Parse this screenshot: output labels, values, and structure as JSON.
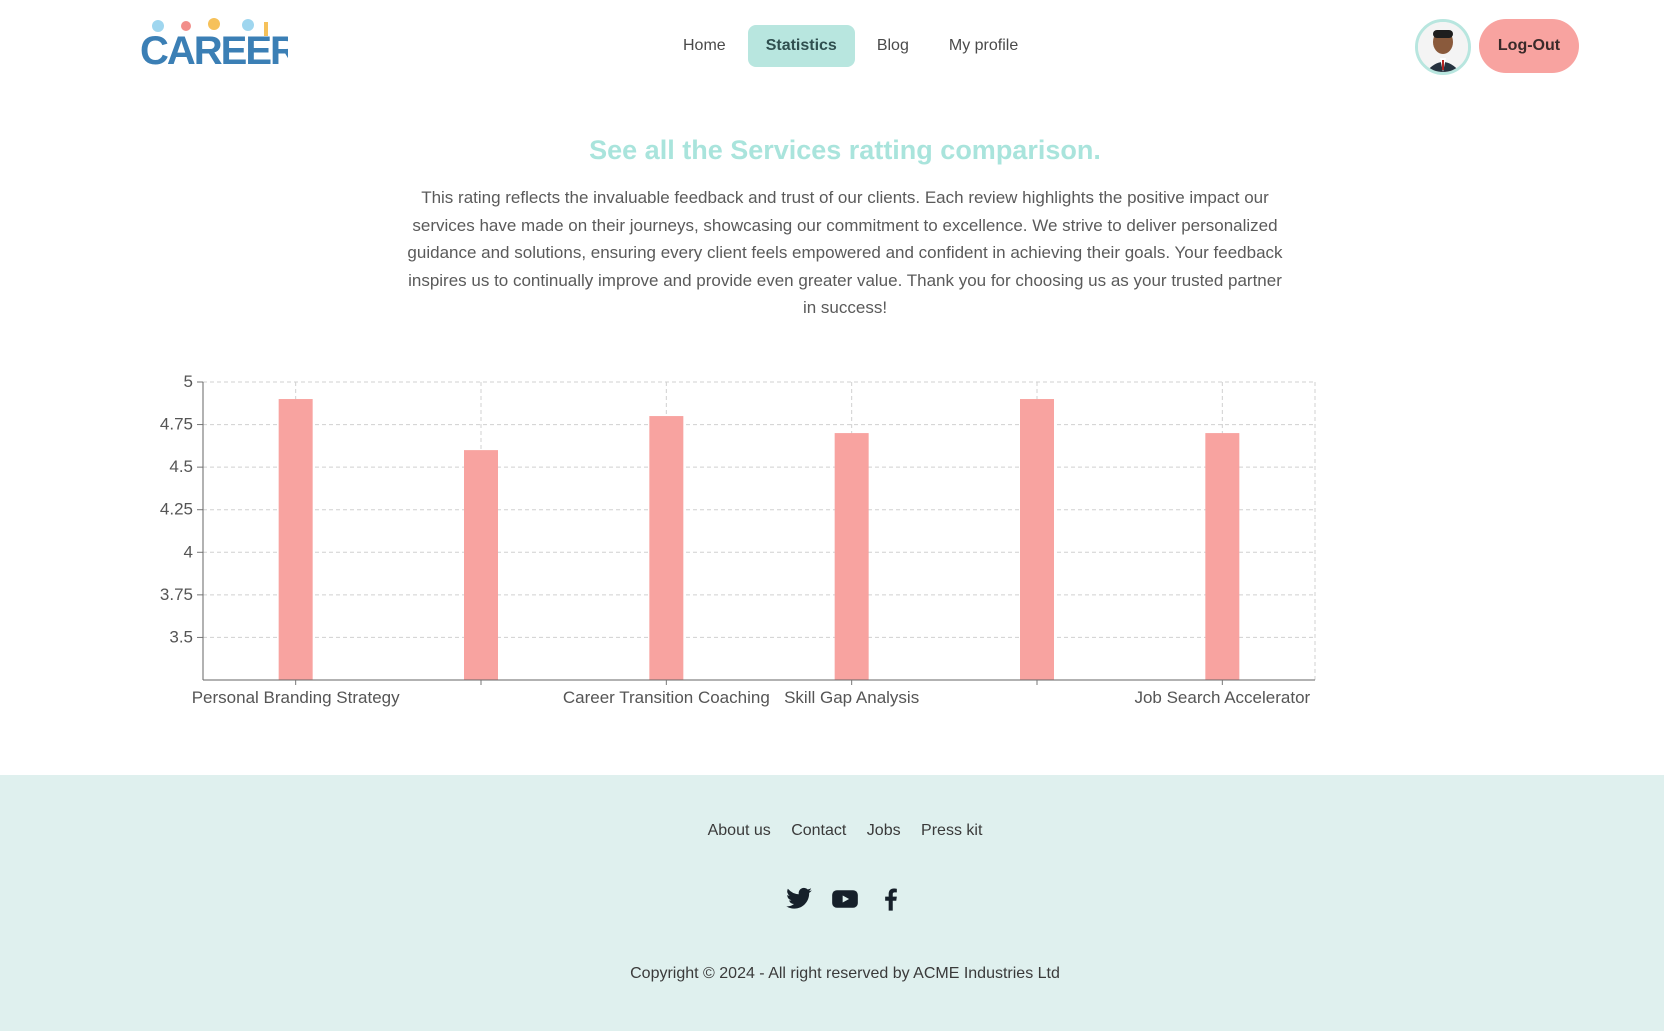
{
  "nav": {
    "items": [
      {
        "label": "Home"
      },
      {
        "label": "Statistics"
      },
      {
        "label": "Blog"
      },
      {
        "label": "My profile"
      }
    ],
    "logout_label": "Log-Out"
  },
  "hero": {
    "title": "See all the Services ratting comparison.",
    "description": "This rating reflects the invaluable feedback and trust of our clients. Each review highlights the positive impact our services have made on their journeys, showcasing our commitment to excellence. We strive to deliver personalized guidance and solutions, ensuring every client feels empowered and confident in achieving their goals. Your feedback inspires us to continually improve and provide even greater value. Thank you for choosing us as your trusted partner in success!"
  },
  "chart_data": {
    "type": "bar",
    "categories": [
      "Personal Branding Strategy",
      "",
      "Career Transition Coaching",
      "Skill Gap Analysis",
      "",
      "Job Search Accelerator"
    ],
    "values": [
      4.9,
      4.6,
      4.8,
      4.7,
      4.9,
      4.7
    ],
    "ylim": [
      3.25,
      5
    ],
    "yticks": [
      "5",
      "4.75",
      "4.5",
      "4.25",
      "4",
      "3.75",
      "3.5"
    ],
    "bar_color": "#f8a3a0",
    "grid": "dashed"
  },
  "footer": {
    "links": [
      {
        "label": "About us"
      },
      {
        "label": "Contact"
      },
      {
        "label": "Jobs"
      },
      {
        "label": "Press kit"
      }
    ],
    "social": [
      "twitter-icon",
      "youtube-icon",
      "facebook-icon"
    ],
    "copyright": "Copyright © 2024 - All right reserved by ACME Industries Ltd"
  },
  "colors": {
    "accent": "#b8e6df",
    "headline": "#a9e4dc",
    "logout": "#f8a3a0",
    "footer_bg": "#dff0ee"
  }
}
